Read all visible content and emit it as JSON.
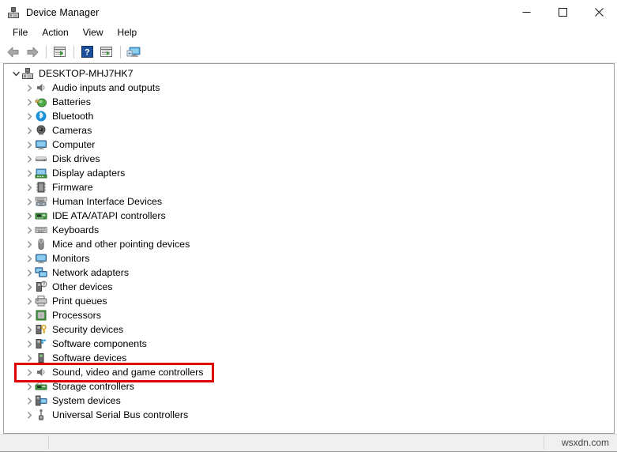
{
  "window": {
    "title": "Device Manager",
    "icon": "device-manager-icon",
    "controls": [
      {
        "name": "minimize-button",
        "glyph": "minimize"
      },
      {
        "name": "maximize-button",
        "glyph": "maximize"
      },
      {
        "name": "close-button",
        "glyph": "close"
      }
    ]
  },
  "menubar": {
    "items": [
      {
        "label": "File"
      },
      {
        "label": "Action"
      },
      {
        "label": "View"
      },
      {
        "label": "Help"
      }
    ]
  },
  "toolbar": {
    "buttons": [
      {
        "name": "back-button",
        "icon": "back-arrow-icon"
      },
      {
        "name": "forward-button",
        "icon": "forward-arrow-icon"
      },
      {
        "name": "separator-1",
        "icon": "separator"
      },
      {
        "name": "properties-button",
        "icon": "properties-icon"
      },
      {
        "name": "separator-2",
        "icon": "separator"
      },
      {
        "name": "help-button",
        "icon": "help-question-icon"
      },
      {
        "name": "update-driver-button",
        "icon": "update-driver-icon"
      },
      {
        "name": "separator-3",
        "icon": "separator"
      },
      {
        "name": "scan-hardware-changes-button",
        "icon": "scan-monitor-icon"
      }
    ]
  },
  "tree": {
    "root": {
      "label": "DESKTOP-MHJ7HK7",
      "icon": "computer-root-icon",
      "expanded": true
    },
    "items": [
      {
        "label": "Audio inputs and outputs",
        "icon": "speaker-icon"
      },
      {
        "label": "Batteries",
        "icon": "battery-icon"
      },
      {
        "label": "Bluetooth",
        "icon": "bluetooth-icon"
      },
      {
        "label": "Cameras",
        "icon": "camera-icon"
      },
      {
        "label": "Computer",
        "icon": "monitor-icon"
      },
      {
        "label": "Disk drives",
        "icon": "disk-drive-icon"
      },
      {
        "label": "Display adapters",
        "icon": "display-adapter-icon"
      },
      {
        "label": "Firmware",
        "icon": "firmware-chip-icon"
      },
      {
        "label": "Human Interface Devices",
        "icon": "hid-icon"
      },
      {
        "label": "IDE ATA/ATAPI controllers",
        "icon": "ide-controller-icon"
      },
      {
        "label": "Keyboards",
        "icon": "keyboard-icon"
      },
      {
        "label": "Mice and other pointing devices",
        "icon": "mouse-icon"
      },
      {
        "label": "Monitors",
        "icon": "monitor-icon"
      },
      {
        "label": "Network adapters",
        "icon": "network-adapter-icon"
      },
      {
        "label": "Other devices",
        "icon": "other-device-question-icon"
      },
      {
        "label": "Print queues",
        "icon": "printer-icon"
      },
      {
        "label": "Processors",
        "icon": "processor-icon"
      },
      {
        "label": "Security devices",
        "icon": "security-key-icon"
      },
      {
        "label": "Software components",
        "icon": "software-component-icon"
      },
      {
        "label": "Software devices",
        "icon": "software-device-icon"
      },
      {
        "label": "Sound, video and game controllers",
        "icon": "speaker-icon",
        "highlighted": true
      },
      {
        "label": "Storage controllers",
        "icon": "storage-controller-icon"
      },
      {
        "label": "System devices",
        "icon": "system-device-icon"
      },
      {
        "label": "Universal Serial Bus controllers",
        "icon": "usb-icon"
      }
    ]
  },
  "statusbar": {
    "pane1": "",
    "pane2": "",
    "watermark": "wsxdn.com"
  },
  "colors": {
    "highlight": "#e00000",
    "bluetooth": "#1e90d8",
    "green_card": "#3a9a3a",
    "window_bg": "#ffffff",
    "status_bg": "#f0f0f0"
  }
}
